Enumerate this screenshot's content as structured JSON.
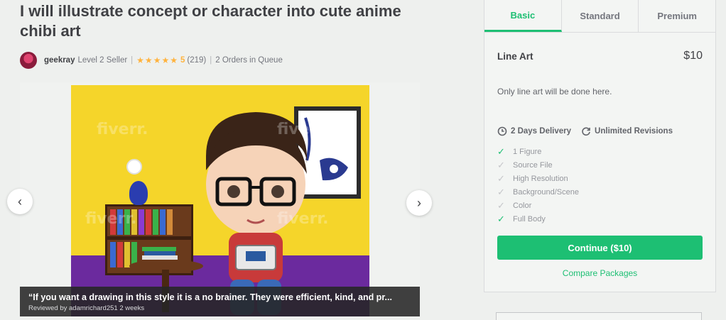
{
  "gig": {
    "title": "I will illustrate concept or character into cute anime chibi art"
  },
  "seller": {
    "name": "geekray",
    "level": "Level 2 Seller",
    "stars": "★★★★★",
    "rating": "5",
    "reviews_count": "(219)",
    "orders_in_queue": "2 Orders in Queue"
  },
  "gallery": {
    "watermark": "fiverr.",
    "prev_icon": "chevron-left-icon",
    "next_icon": "chevron-right-icon",
    "review_quote": "“If you want a drawing in this style it is a no brainer. They were efficient, kind, and pr...",
    "review_by": "Reviewed by adamrichard251 2 weeks"
  },
  "packages": {
    "tabs": [
      "Basic",
      "Standard",
      "Premium"
    ],
    "active_tab": "Basic",
    "name": "Line Art",
    "price": "$10",
    "description": "Only line art will be done here.",
    "delivery": "2 Days Delivery",
    "revisions": "Unlimited Revisions",
    "features": [
      {
        "label": "1 Figure",
        "included": true
      },
      {
        "label": "Source File",
        "included": false
      },
      {
        "label": "High Resolution",
        "included": false
      },
      {
        "label": "Background/Scene",
        "included": false
      },
      {
        "label": "Color",
        "included": false
      },
      {
        "label": "Full Body",
        "included": true
      }
    ],
    "continue_label": "Continue ($10)",
    "compare_label": "Compare Packages"
  },
  "colors": {
    "brand_green": "#1dbf73",
    "star": "#ffb33e",
    "text_dark": "#404145"
  }
}
